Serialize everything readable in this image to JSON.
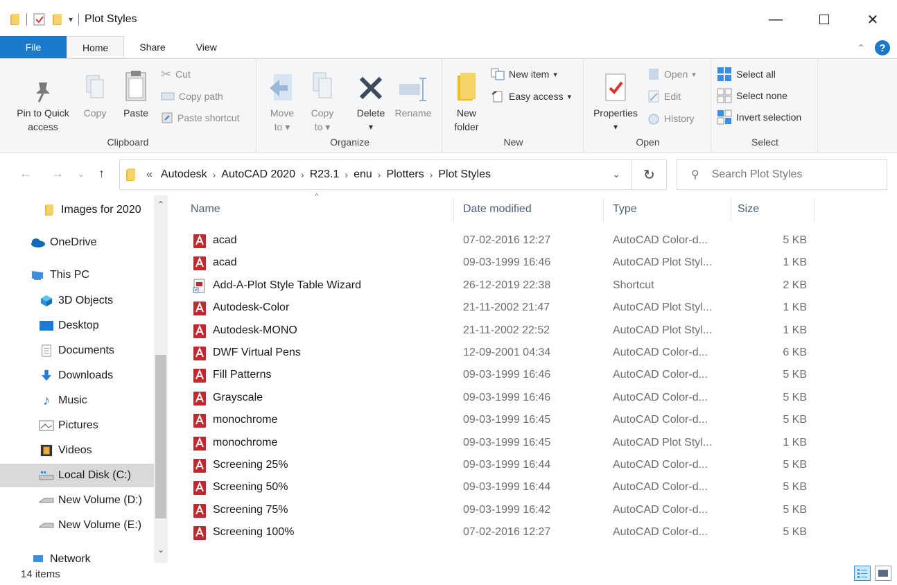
{
  "window": {
    "title": "Plot Styles",
    "controls": [
      "minimize-icon",
      "maximize-icon",
      "close-icon"
    ]
  },
  "tabs": [
    {
      "label": "File"
    },
    {
      "label": "Home"
    },
    {
      "label": "Share"
    },
    {
      "label": "View"
    }
  ],
  "ribbon": {
    "clipboard": {
      "label": "Clipboard",
      "pin_line1": "Pin to Quick",
      "pin_line2": "access",
      "copy": "Copy",
      "paste": "Paste",
      "cut": "Cut",
      "copy_path": "Copy path",
      "paste_shortcut": "Paste shortcut"
    },
    "organize": {
      "label": "Organize",
      "move_line1": "Move",
      "move_line2": "to",
      "copy_line1": "Copy",
      "copy_line2": "to",
      "delete": "Delete",
      "rename": "Rename"
    },
    "new": {
      "label": "New",
      "new_folder_line1": "New",
      "new_folder_line2": "folder",
      "new_item": "New item",
      "easy_access": "Easy access"
    },
    "open": {
      "label": "Open",
      "properties": "Properties",
      "open": "Open",
      "edit": "Edit",
      "history": "History"
    },
    "select": {
      "label": "Select",
      "select_all": "Select all",
      "select_none": "Select none",
      "invert": "Invert selection"
    }
  },
  "address": {
    "overflow": "«",
    "crumbs": [
      "Autodesk",
      "AutoCAD 2020",
      "R23.1",
      "enu",
      "Plotters",
      "Plot Styles"
    ]
  },
  "search": {
    "placeholder": "Search Plot Styles"
  },
  "sidebar": {
    "items": [
      {
        "label": "Images for 2020",
        "icon": "folder-icon"
      },
      {
        "label": "OneDrive",
        "icon": "cloud-icon"
      },
      {
        "label": "This PC",
        "icon": "computer-icon"
      },
      {
        "label": "3D Objects",
        "icon": "cube-icon"
      },
      {
        "label": "Desktop",
        "icon": "desktop-icon"
      },
      {
        "label": "Documents",
        "icon": "document-icon"
      },
      {
        "label": "Downloads",
        "icon": "download-icon"
      },
      {
        "label": "Music",
        "icon": "music-icon"
      },
      {
        "label": "Pictures",
        "icon": "pictures-icon"
      },
      {
        "label": "Videos",
        "icon": "videos-icon"
      },
      {
        "label": "Local Disk (C:)",
        "icon": "drive-icon",
        "selected": true
      },
      {
        "label": "New Volume (D:)",
        "icon": "drive-icon"
      },
      {
        "label": "New Volume (E:)",
        "icon": "drive-icon"
      },
      {
        "label": "Network",
        "icon": "network-icon"
      }
    ]
  },
  "columns": {
    "name": "Name",
    "date": "Date modified",
    "type": "Type",
    "size": "Size"
  },
  "files": [
    {
      "name": "acad",
      "date": "07-02-2016 12:27",
      "type": "AutoCAD Color-d...",
      "size": "5 KB",
      "icon": "autocad-icon"
    },
    {
      "name": "acad",
      "date": "09-03-1999 16:46",
      "type": "AutoCAD Plot Styl...",
      "size": "1 KB",
      "icon": "autocad-icon"
    },
    {
      "name": "Add-A-Plot Style Table Wizard",
      "date": "26-12-2019 22:38",
      "type": "Shortcut",
      "size": "2 KB",
      "icon": "shortcut-icon"
    },
    {
      "name": "Autodesk-Color",
      "date": "21-11-2002 21:47",
      "type": "AutoCAD Plot Styl...",
      "size": "1 KB",
      "icon": "autocad-icon"
    },
    {
      "name": "Autodesk-MONO",
      "date": "21-11-2002 22:52",
      "type": "AutoCAD Plot Styl...",
      "size": "1 KB",
      "icon": "autocad-icon"
    },
    {
      "name": "DWF Virtual Pens",
      "date": "12-09-2001 04:34",
      "type": "AutoCAD Color-d...",
      "size": "6 KB",
      "icon": "autocad-icon"
    },
    {
      "name": "Fill Patterns",
      "date": "09-03-1999 16:46",
      "type": "AutoCAD Color-d...",
      "size": "5 KB",
      "icon": "autocad-icon"
    },
    {
      "name": "Grayscale",
      "date": "09-03-1999 16:46",
      "type": "AutoCAD Color-d...",
      "size": "5 KB",
      "icon": "autocad-icon"
    },
    {
      "name": "monochrome",
      "date": "09-03-1999 16:45",
      "type": "AutoCAD Color-d...",
      "size": "5 KB",
      "icon": "autocad-icon"
    },
    {
      "name": "monochrome",
      "date": "09-03-1999 16:45",
      "type": "AutoCAD Plot Styl...",
      "size": "1 KB",
      "icon": "autocad-icon"
    },
    {
      "name": "Screening 25%",
      "date": "09-03-1999 16:44",
      "type": "AutoCAD Color-d...",
      "size": "5 KB",
      "icon": "autocad-icon"
    },
    {
      "name": "Screening 50%",
      "date": "09-03-1999 16:44",
      "type": "AutoCAD Color-d...",
      "size": "5 KB",
      "icon": "autocad-icon"
    },
    {
      "name": "Screening 75%",
      "date": "09-03-1999 16:42",
      "type": "AutoCAD Color-d...",
      "size": "5 KB",
      "icon": "autocad-icon"
    },
    {
      "name": "Screening 100%",
      "date": "07-02-2016 12:27",
      "type": "AutoCAD Color-d...",
      "size": "5 KB",
      "icon": "autocad-icon"
    }
  ],
  "status": {
    "item_count": "14 items"
  },
  "colors": {
    "accent": "#1979ca",
    "autocad_red": "#c1272d",
    "folder_yellow": "#f4c542"
  }
}
